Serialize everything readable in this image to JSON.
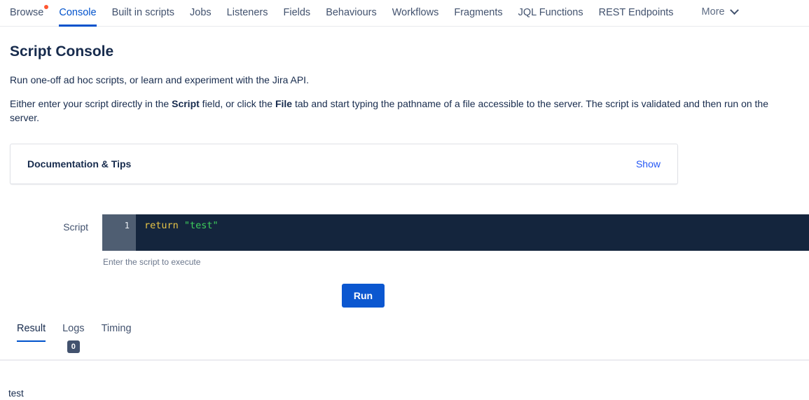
{
  "nav": {
    "items": [
      {
        "label": "Browse",
        "active": false,
        "dot": true
      },
      {
        "label": "Console",
        "active": true,
        "dot": false
      },
      {
        "label": "Built in scripts",
        "active": false,
        "dot": false
      },
      {
        "label": "Jobs",
        "active": false,
        "dot": false
      },
      {
        "label": "Listeners",
        "active": false,
        "dot": false
      },
      {
        "label": "Fields",
        "active": false,
        "dot": false
      },
      {
        "label": "Behaviours",
        "active": false,
        "dot": false
      },
      {
        "label": "Workflows",
        "active": false,
        "dot": false
      },
      {
        "label": "Fragments",
        "active": false,
        "dot": false
      },
      {
        "label": "JQL Functions",
        "active": false,
        "dot": false
      },
      {
        "label": "REST Endpoints",
        "active": false,
        "dot": false
      }
    ],
    "more_label": "More",
    "more_icon": "chevron-down-icon",
    "active_color": "#0052CC",
    "dot_color": "#FF5630"
  },
  "page": {
    "title": "Script Console",
    "intro_line1": "Run one-off ad hoc scripts, or learn and experiment with the Jira API.",
    "intro_line2": {
      "part1": "Either enter your script directly in the ",
      "bold1": "Script",
      "part2": " field, or click the ",
      "bold2": "File",
      "part3": " tab and start typing the pathname of a file accessible to the server. The script is validated and then run on the server."
    }
  },
  "documentation": {
    "title": "Documentation & Tips",
    "toggle_label": "Show",
    "link_color": "#2457F5"
  },
  "script": {
    "label": "Script",
    "line_number": "1",
    "code": {
      "keyword": "return ",
      "string": "\"test\""
    },
    "helper_text": "Enter the script to execute",
    "editor_bg": "#14253D",
    "gutter_bg": "#4F5E72",
    "keyword_color": "#E8C547",
    "string_color": "#3ECF5C"
  },
  "run": {
    "label": "Run",
    "color": "#0B57D0"
  },
  "result_tabs": {
    "items": [
      {
        "label": "Result",
        "active": true,
        "badge": null
      },
      {
        "label": "Logs",
        "active": false,
        "badge": "0"
      },
      {
        "label": "Timing",
        "active": false,
        "badge": null
      }
    ],
    "badge_color": "#42526E"
  },
  "result_output": {
    "text": "test"
  }
}
